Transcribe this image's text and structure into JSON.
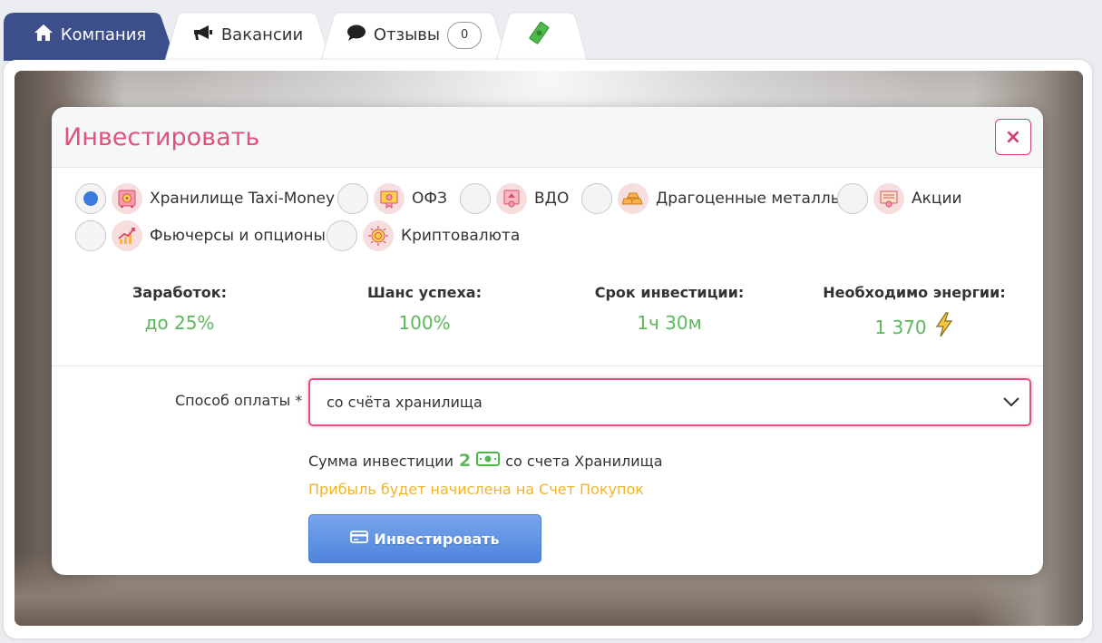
{
  "tabs": [
    {
      "label": "Компания",
      "icon": "home-icon",
      "active": true
    },
    {
      "label": "Вакансии",
      "icon": "megaphone-icon",
      "active": false
    },
    {
      "label": "Отзывы",
      "icon": "comment-icon",
      "badge": "0",
      "active": false
    },
    {
      "label": "",
      "icon": "money-icon",
      "active": false
    }
  ],
  "modal": {
    "title": "Инвестировать",
    "close_icon": "×",
    "options": [
      {
        "label": "Хранилище Taxi-Money",
        "icon": "safe-icon",
        "checked": true
      },
      {
        "label": "ОФЗ",
        "icon": "bond-certificate-icon",
        "checked": false
      },
      {
        "label": "ВДО",
        "icon": "bond-certificate-icon",
        "checked": false
      },
      {
        "label": "Драгоценные металлы",
        "icon": "gold-bars-icon",
        "checked": false
      },
      {
        "label": "Акции",
        "icon": "stock-certificate-icon",
        "checked": false
      },
      {
        "label": "Фьючерсы и опционы",
        "icon": "chart-growth-icon",
        "checked": false
      },
      {
        "label": "Криптовалюта",
        "icon": "crypto-coin-icon",
        "checked": false
      }
    ],
    "stats": [
      {
        "label": "Заработок:",
        "value": "до 25%"
      },
      {
        "label": "Шанс успеха:",
        "value": "100%"
      },
      {
        "label": "Срок инвестиции:",
        "value": "1ч 30м"
      },
      {
        "label": "Необходимо энергии:",
        "value": "1 370",
        "icon": "lightning-icon"
      }
    ],
    "payment": {
      "label": "Способ оплаты *",
      "selected": "со счёта хранилища"
    },
    "sum": {
      "prefix": "Сумма инвестиции",
      "amount": "2",
      "suffix": "со счета Хранилища"
    },
    "profit_note": "Прибыль будет начислена на Счет Покупок",
    "invest_button": "Инвестировать"
  },
  "colors": {
    "tab_active": "#3d4f8a",
    "title": "#e0527a",
    "green": "#5cb85c",
    "note": "#f0b429",
    "button": "#5a8ee0"
  }
}
